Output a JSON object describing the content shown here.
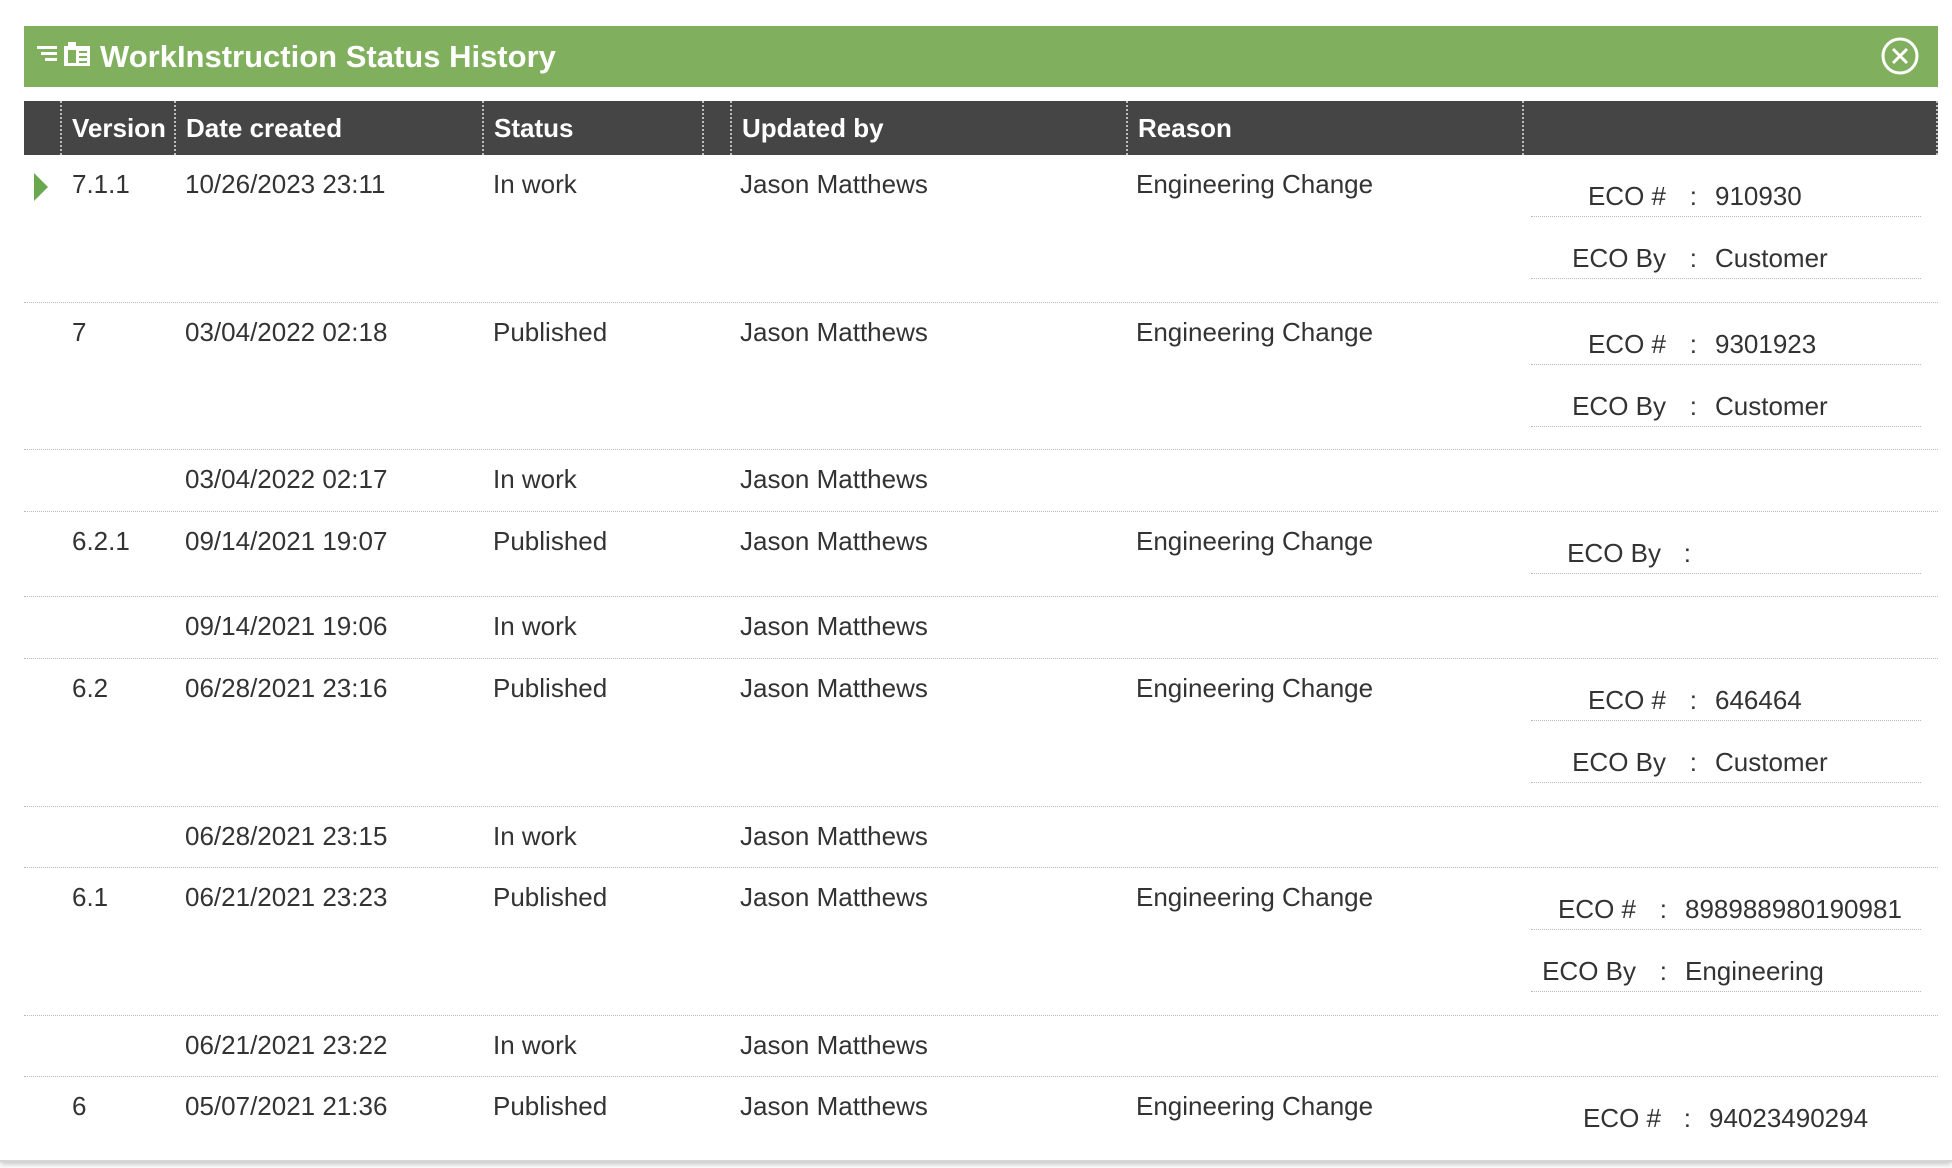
{
  "dialog": {
    "title": "WorkInstruction Status History",
    "icons": [
      "collapse-lines-icon",
      "document-icon",
      "close-circle-icon"
    ],
    "accent_color": "#80b05d",
    "header_color": "#454545"
  },
  "columns": [
    "Version",
    "Date created",
    "Status",
    "Updated by",
    "Reason",
    ""
  ],
  "rows": [
    {
      "version": "7.1.1",
      "date": "10/26/2023 23:11",
      "status": "In work",
      "updated_by": "Jason Matthews",
      "reason": "Engineering Change",
      "eco_num_label": "ECO #",
      "eco_num": "910930",
      "eco_by_label": "ECO By",
      "eco_by": "Customer"
    },
    {
      "version": "7",
      "date": "03/04/2022 02:18",
      "status": "Published",
      "updated_by": "Jason Matthews",
      "reason": "Engineering Change",
      "eco_num_label": "ECO #",
      "eco_num": "9301923",
      "eco_by_label": "ECO By",
      "eco_by": "Customer"
    },
    {
      "version": "",
      "date": "03/04/2022 02:17",
      "status": "In work",
      "updated_by": "Jason Matthews",
      "reason": ""
    },
    {
      "version": "6.2.1",
      "date": "09/14/2021 19:07",
      "status": "Published",
      "updated_by": "Jason Matthews",
      "reason": "Engineering Change",
      "eco_by_label": "ECO By",
      "eco_by": ""
    },
    {
      "version": "",
      "date": "09/14/2021 19:06",
      "status": "In work",
      "updated_by": "Jason Matthews",
      "reason": ""
    },
    {
      "version": "6.2",
      "date": "06/28/2021 23:16",
      "status": "Published",
      "updated_by": "Jason Matthews",
      "reason": "Engineering Change",
      "eco_num_label": "ECO #",
      "eco_num": "646464",
      "eco_by_label": "ECO By",
      "eco_by": "Customer"
    },
    {
      "version": "",
      "date": "06/28/2021 23:15",
      "status": "In work",
      "updated_by": "Jason Matthews",
      "reason": ""
    },
    {
      "version": "6.1",
      "date": "06/21/2021 23:23",
      "status": "Published",
      "updated_by": "Jason Matthews",
      "reason": "Engineering Change",
      "eco_num_label": "ECO #",
      "eco_num": "898988980190981",
      "eco_by_label": "ECO By",
      "eco_by": "Engineering"
    },
    {
      "version": "",
      "date": "06/21/2021 23:22",
      "status": "In work",
      "updated_by": "Jason Matthews",
      "reason": ""
    },
    {
      "version": "6",
      "date": "05/07/2021 21:36",
      "status": "Published",
      "updated_by": "Jason Matthews",
      "reason": "Engineering Change",
      "eco_num_label": "ECO #",
      "eco_num": "94023490294"
    }
  ],
  "separator": ":"
}
